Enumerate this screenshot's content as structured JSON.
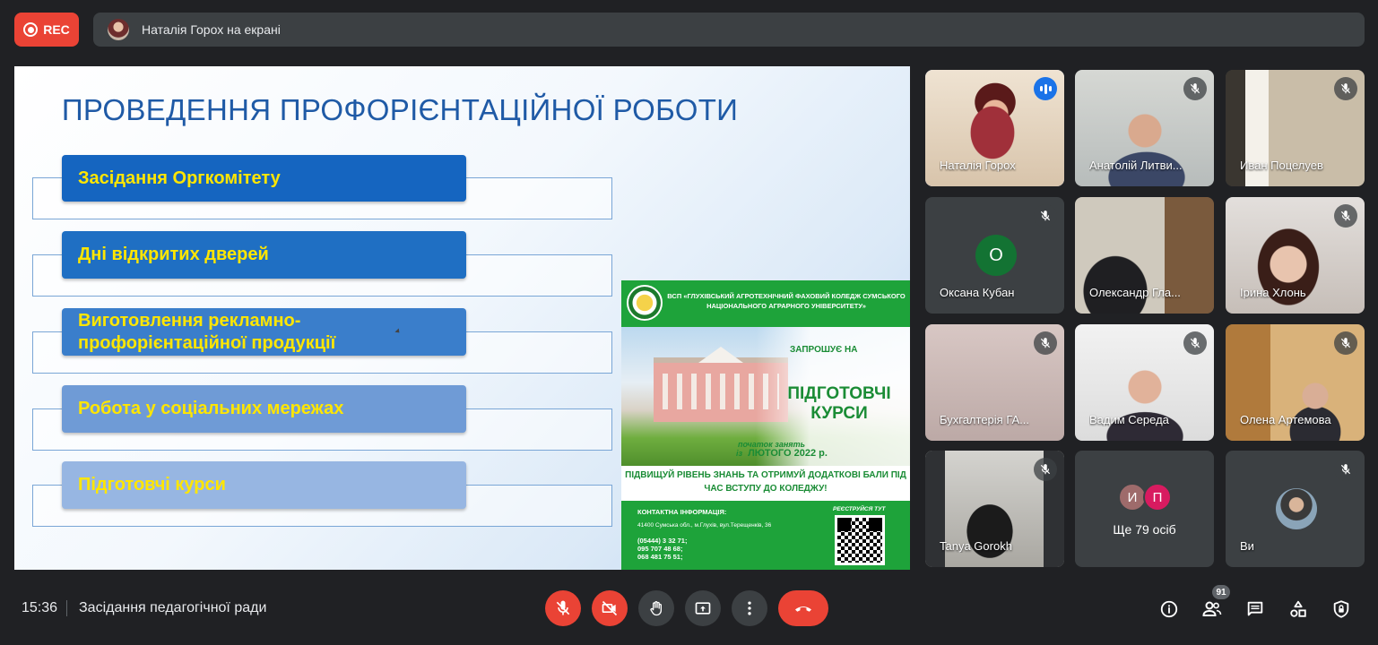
{
  "recording": {
    "label": "REC"
  },
  "presenting_bar": {
    "text": "Наталія Горох на екрані"
  },
  "slide": {
    "title": "ПРОВЕДЕННЯ ПРОФОРІЄНТАЦІЙНОЇ РОБОТИ",
    "items": [
      {
        "label": "Засідання Оргкомітету",
        "color": "#1565c0"
      },
      {
        "label": "Дні відкритих дверей",
        "color": "#1f6fc3"
      },
      {
        "label": "Виготовлення рекламно-профорієнтаційної продукції",
        "color": "#3a7ecb"
      },
      {
        "label": "Робота у соціальних мережах",
        "color": "#6f9bd6"
      },
      {
        "label": "Підготовчі курси",
        "color": "#97b6e2"
      }
    ]
  },
  "poster": {
    "college": "ВСП «ГЛУХІВСЬКИЙ АГРОТЕХНІЧНИЙ ФАХОВИЙ КОЛЕДЖ СУМСЬКОГО НАЦІОНАЛЬНОГО АГРАРНОГО УНІВЕРСИТЕТУ»",
    "invite": "ЗАПРОШУЄ НА",
    "courses": "ПІДГОТОВЧІ КУРСИ",
    "start": "початок занять",
    "start_from": "із",
    "start_date": "ЛЮТОГО 2022 р.",
    "slogan": "ПІДВИЩУЙ РІВЕНЬ ЗНАНЬ ТА ОТРИМУЙ ДОДАТКОВІ БАЛИ ПІД ЧАС ВСТУПУ ДО КОЛЕДЖУ!",
    "contacts_title": "КОНТАКТНА ІНФОРМАЦІЯ:",
    "address": "41400 Сумська обл., м.Глухів, вул.Терещенків, 36",
    "phone1": "(05444) 3 32 71;",
    "phone2": "095 707 48 68;",
    "phone3": "068 481 75 51;",
    "register": "РЕЄСТРУЙСЯ ТУТ"
  },
  "participants": [
    {
      "name": "Наталія Горох",
      "speaking": true
    },
    {
      "name": "Анатолій Литви...",
      "muted": true
    },
    {
      "name": "Иван Поцелуев",
      "muted": true
    },
    {
      "name": "Оксана Кубан",
      "muted": true,
      "initial": "O",
      "avatar_color": "#137333"
    },
    {
      "name": "Олександр Гла...",
      "muted": true
    },
    {
      "name": "Ірина Хлонь",
      "muted": true
    },
    {
      "name": "Бухгалтерія ГА...",
      "muted": true
    },
    {
      "name": "Вадим Середа",
      "muted": true
    },
    {
      "name": "Олена Артемова",
      "muted": true
    },
    {
      "name": "Tanya Gorokh",
      "muted": true
    },
    {
      "more": "Ще 79 осіб",
      "initials": [
        "И",
        "П"
      ],
      "colors": [
        "#9e6b6b",
        "#d81b60"
      ]
    },
    {
      "name": "Ви",
      "muted": true
    }
  ],
  "bottom": {
    "time": "15:36",
    "meeting_title": "Засідання педагогічної ради",
    "people_count": "91"
  },
  "icons": [
    "mic-off-icon",
    "camera-off-icon",
    "raise-hand-icon",
    "present-icon",
    "more-vert-icon",
    "call-end-icon",
    "info-icon",
    "people-icon",
    "chat-icon",
    "activities-icon",
    "host-controls-icon"
  ]
}
